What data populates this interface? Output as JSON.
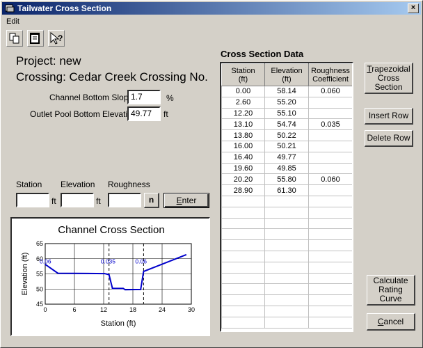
{
  "window": {
    "title": "Tailwater Cross Section",
    "close_glyph": "×"
  },
  "menu": {
    "items": [
      "Edit"
    ]
  },
  "toolbar": {
    "icons": [
      "copy-icon",
      "paste-icon",
      "help-icon"
    ]
  },
  "project": {
    "label": "Project: new"
  },
  "crossing": {
    "label": "Crossing: Cedar Creek Crossing No."
  },
  "form": {
    "slope_label": "Channel Bottom Slope:",
    "slope_value": "1.7",
    "slope_unit": "%",
    "pool_label": "Outlet Pool Bottom Elevation:",
    "pool_value": "49.77",
    "pool_unit": "ft",
    "station_label": "Station",
    "elevation_label": "Elevation",
    "roughness_label": "Roughness",
    "station_unit": "ft",
    "elevation_unit": "ft",
    "n_label": "n",
    "enter_label": "Enter",
    "enter_underline": "E",
    "enter_rest": "nter"
  },
  "grid": {
    "title": "Cross Section Data",
    "headers": [
      "Station\n(ft)",
      "Elevation\n(ft)",
      "Roughness\nCoefficient"
    ],
    "rows": [
      [
        "0.00",
        "58.14",
        "0.060"
      ],
      [
        "2.60",
        "55.20",
        ""
      ],
      [
        "12.20",
        "55.10",
        ""
      ],
      [
        "13.10",
        "54.74",
        "0.035"
      ],
      [
        "13.80",
        "50.22",
        ""
      ],
      [
        "16.00",
        "50.21",
        ""
      ],
      [
        "16.40",
        "49.77",
        ""
      ],
      [
        "19.60",
        "49.85",
        ""
      ],
      [
        "20.20",
        "55.80",
        "0.060"
      ],
      [
        "28.90",
        "61.30",
        ""
      ]
    ],
    "empty_rows": 12
  },
  "buttons": {
    "trapezoidal_u": "T",
    "trapezoidal_rest1": "rapezoidal",
    "trapezoidal_line2": "Cross",
    "trapezoidal_line3": "Section",
    "insert_row": "Insert Row",
    "delete_row": "Delete Row",
    "calculate_line1": "Calculate",
    "calculate_line2": "Rating",
    "calculate_line3": "Curve",
    "cancel_u": "C",
    "cancel_rest": "ancel"
  },
  "chart_data": {
    "type": "line",
    "title": "Channel Cross Section",
    "xlabel": "Station (ft)",
    "ylabel": "Elevation (ft)",
    "xlim": [
      0,
      30
    ],
    "ylim": [
      45,
      65
    ],
    "xticks": [
      0,
      6,
      12,
      18,
      24,
      30
    ],
    "yticks": [
      45,
      50,
      55,
      60,
      65
    ],
    "grid": true,
    "series": [
      {
        "x": [
          0.0,
          2.6,
          12.2,
          13.1,
          13.8,
          16.0,
          16.4,
          19.6,
          20.2,
          28.9
        ],
        "y": [
          58.14,
          55.2,
          55.1,
          54.74,
          50.22,
          50.21,
          49.77,
          49.85,
          55.8,
          61.3
        ]
      }
    ],
    "roughness_breaks": [
      {
        "x": 0.0,
        "label": "0.06"
      },
      {
        "x": 13.1,
        "label": "0.035"
      },
      {
        "x": 20.2,
        "label": "0.06"
      }
    ],
    "line_color": "#0000cc"
  }
}
